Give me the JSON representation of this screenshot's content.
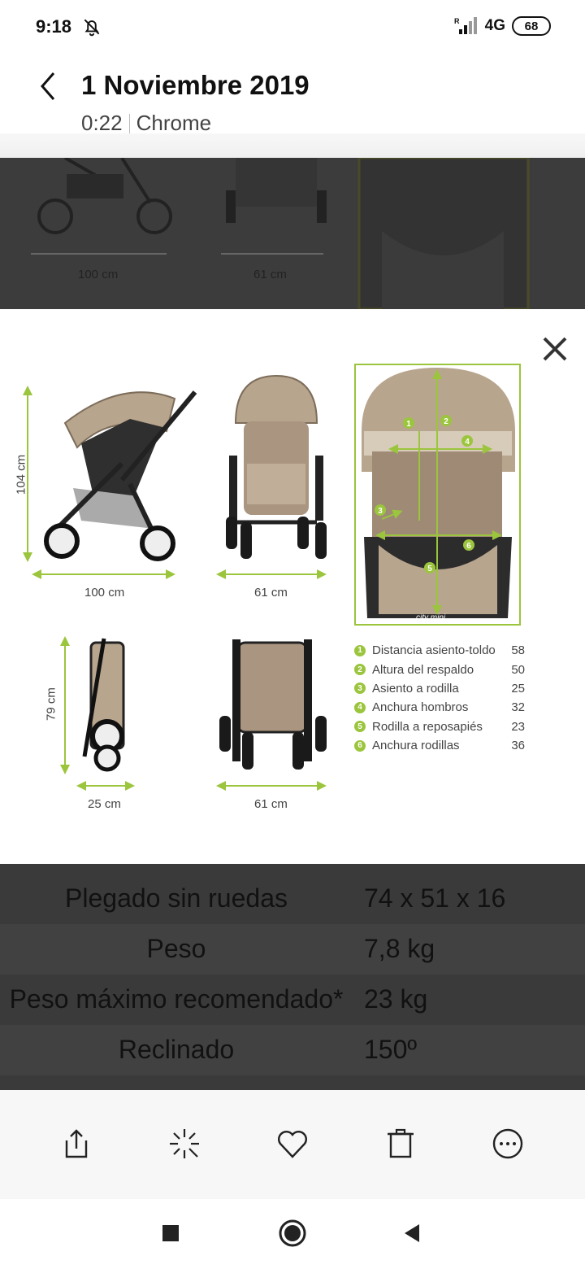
{
  "status_bar": {
    "time": "9:18",
    "network": "4G",
    "battery": "68"
  },
  "header": {
    "title": "1 Noviembre 2019",
    "duration": "0:22",
    "source": "Chrome"
  },
  "image": {
    "dimensions": {
      "height_unfolded": "104 cm",
      "length_unfolded": "100 cm",
      "width_front": "61 cm",
      "height_folded": "79 cm",
      "depth_folded": "25 cm",
      "width_folded": "61 cm"
    },
    "brand": "city mini",
    "legend": [
      {
        "num": "1",
        "label": "Distancia asiento-toldo",
        "value": "58"
      },
      {
        "num": "2",
        "label": "Altura del respaldo",
        "value": "50"
      },
      {
        "num": "3",
        "label": "Asiento a rodilla",
        "value": "25"
      },
      {
        "num": "4",
        "label": "Anchura hombros",
        "value": "32"
      },
      {
        "num": "5",
        "label": "Rodilla a reposapiés",
        "value": "23"
      },
      {
        "num": "6",
        "label": "Anchura rodillas",
        "value": "36"
      }
    ]
  },
  "background_page": {
    "dims": {
      "length": "100 cm",
      "width": "61 cm"
    },
    "specs": [
      {
        "label": "Plegado sin ruedas",
        "value": "74 x 51 x 16"
      },
      {
        "label": "Peso",
        "value": "7,8 kg"
      },
      {
        "label": "Peso máximo recomendado*",
        "value": "23 kg"
      },
      {
        "label": "Reclinado",
        "value": "150º"
      }
    ]
  },
  "actions": [
    "share-icon",
    "edit-effects-icon",
    "heart-icon",
    "trash-icon",
    "more-icon"
  ],
  "colors": {
    "accent_green": "#9bc53d",
    "dim_overlay": "#3c3c3c",
    "stroller_beige": "#b8a58e"
  }
}
